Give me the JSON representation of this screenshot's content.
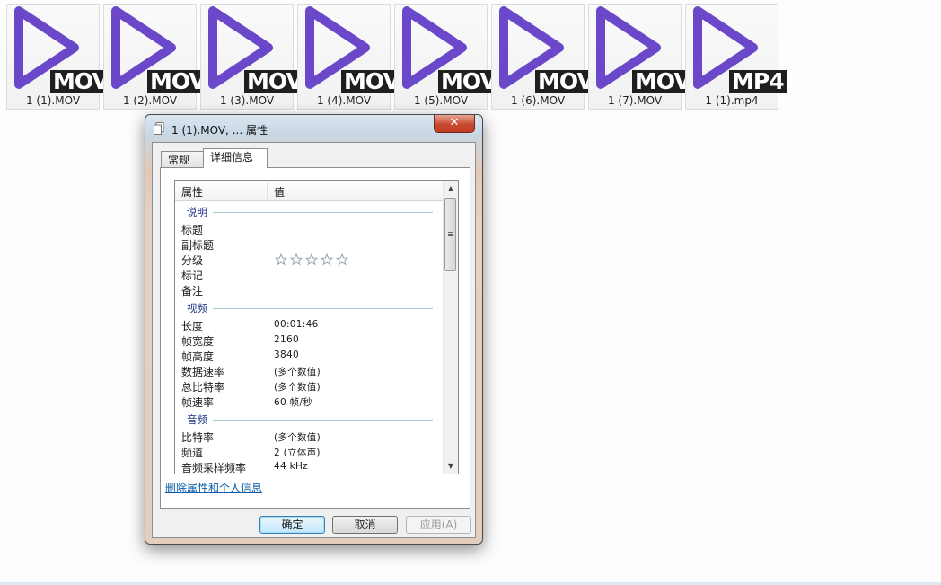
{
  "files": [
    {
      "ext": "MOV",
      "name": "1 (1).MOV"
    },
    {
      "ext": "MOV",
      "name": "1 (2).MOV"
    },
    {
      "ext": "MOV",
      "name": "1 (3).MOV"
    },
    {
      "ext": "MOV",
      "name": "1 (4).MOV"
    },
    {
      "ext": "MOV",
      "name": "1 (5).MOV"
    },
    {
      "ext": "MOV",
      "name": "1 (6).MOV"
    },
    {
      "ext": "MOV",
      "name": "1 (7).MOV"
    },
    {
      "ext": "MP4",
      "name": "1 (1).mp4"
    }
  ],
  "colors": {
    "play_icon": "#6a48c9",
    "badge": "#1f1f1f",
    "link": "#0b5ea8",
    "group_title": "#1e3287"
  },
  "dialog": {
    "title": "1 (1).MOV, ... 属性",
    "close_label": "✕",
    "tabs": {
      "general": "常规",
      "details": "详细信息"
    },
    "selected_tab": "details",
    "header": {
      "name": "属性",
      "value": "值"
    },
    "groups": [
      {
        "title": "说明",
        "rows": [
          {
            "name": "标题",
            "value": ""
          },
          {
            "name": "副标题",
            "value": ""
          },
          {
            "name": "分级",
            "value": "",
            "rating": 0,
            "rating_max": 5
          },
          {
            "name": "标记",
            "value": ""
          },
          {
            "name": "备注",
            "value": ""
          }
        ]
      },
      {
        "title": "视频",
        "rows": [
          {
            "name": "长度",
            "value": "00:01:46"
          },
          {
            "name": "帧宽度",
            "value": "2160"
          },
          {
            "name": "帧高度",
            "value": "3840"
          },
          {
            "name": "数据速率",
            "value": "(多个数值)"
          },
          {
            "name": "总比特率",
            "value": "(多个数值)"
          },
          {
            "name": "帧速率",
            "value": "60 帧/秒"
          }
        ]
      },
      {
        "title": "音频",
        "rows": [
          {
            "name": "比特率",
            "value": "(多个数值)"
          },
          {
            "name": "频道",
            "value": "2 (立体声)"
          },
          {
            "name": "音频采样频率",
            "value": "44 kHz"
          }
        ]
      }
    ],
    "remove_link": "删除属性和个人信息",
    "buttons": {
      "ok": "确定",
      "cancel": "取消",
      "apply": "应用(A)"
    }
  }
}
